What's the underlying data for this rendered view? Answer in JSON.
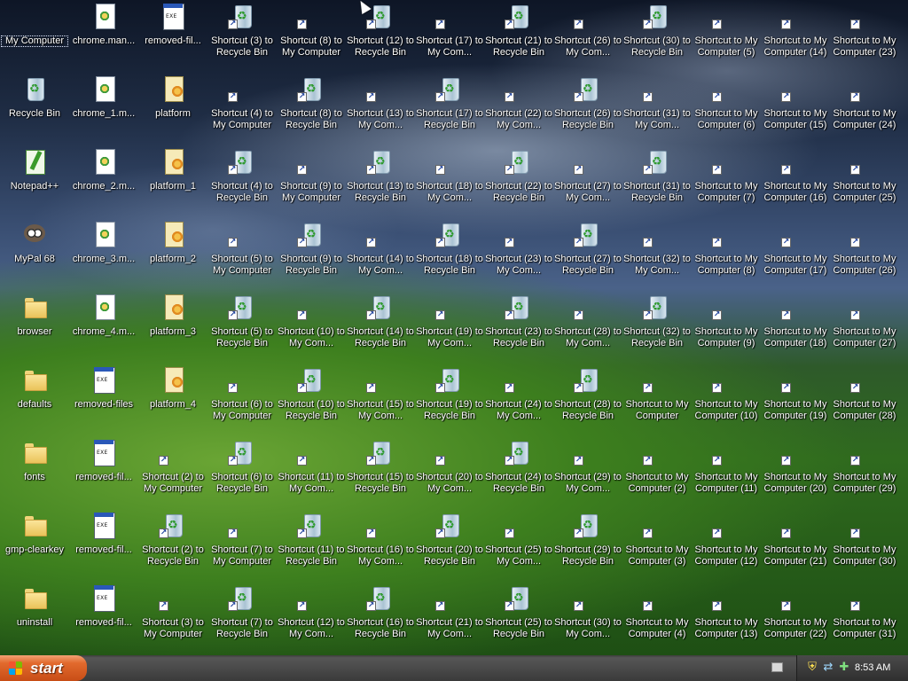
{
  "desktop": {
    "columns": [
      [
        {
          "label": "My Computer",
          "kind": "computer",
          "shortcut": false,
          "selected": true
        },
        {
          "label": "Recycle Bin",
          "kind": "bin",
          "shortcut": false
        },
        {
          "label": "Notepad++",
          "kind": "npp",
          "shortcut": false
        },
        {
          "label": "MyPal 68",
          "kind": "pal",
          "shortcut": false
        },
        {
          "label": "browser",
          "kind": "folder",
          "shortcut": false
        },
        {
          "label": "defaults",
          "kind": "folder",
          "shortcut": false
        },
        {
          "label": "fonts",
          "kind": "folder",
          "shortcut": false
        },
        {
          "label": "gmp-clearkey",
          "kind": "folder",
          "shortcut": false
        },
        {
          "label": "uninstall",
          "kind": "folder",
          "shortcut": false
        }
      ],
      [
        {
          "label": "chrome.man...",
          "kind": "doc",
          "shortcut": false
        },
        {
          "label": "chrome_1.m...",
          "kind": "doc",
          "shortcut": false
        },
        {
          "label": "chrome_2.m...",
          "kind": "doc",
          "shortcut": false
        },
        {
          "label": "chrome_3.m...",
          "kind": "doc",
          "shortcut": false
        },
        {
          "label": "chrome_4.m...",
          "kind": "doc",
          "shortcut": false
        },
        {
          "label": "removed-files",
          "kind": "exe",
          "shortcut": false
        },
        {
          "label": "removed-fil...",
          "kind": "exe",
          "shortcut": false
        },
        {
          "label": "removed-fil...",
          "kind": "exe",
          "shortcut": false
        },
        {
          "label": "removed-fil...",
          "kind": "exe",
          "shortcut": false
        }
      ],
      [
        {
          "label": "removed-fil...",
          "kind": "exe",
          "shortcut": false
        },
        {
          "label": "platform",
          "kind": "text",
          "shortcut": false
        },
        {
          "label": "platform_1",
          "kind": "text",
          "shortcut": false
        },
        {
          "label": "platform_2",
          "kind": "text",
          "shortcut": false
        },
        {
          "label": "platform_3",
          "kind": "text",
          "shortcut": false
        },
        {
          "label": "platform_4",
          "kind": "text",
          "shortcut": false
        },
        {
          "label": "Shortcut (2) to My Computer",
          "kind": "computer",
          "shortcut": true
        },
        {
          "label": "Shortcut (2) to Recycle Bin",
          "kind": "bin",
          "shortcut": true
        },
        {
          "label": "Shortcut (3) to My Computer",
          "kind": "computer",
          "shortcut": true
        }
      ],
      [
        {
          "label": "Shortcut (3) to Recycle Bin",
          "kind": "bin",
          "shortcut": true
        },
        {
          "label": "Shortcut (4) to My Computer",
          "kind": "computer",
          "shortcut": true
        },
        {
          "label": "Shortcut (4) to Recycle Bin",
          "kind": "bin",
          "shortcut": true
        },
        {
          "label": "Shortcut (5) to My Computer",
          "kind": "computer",
          "shortcut": true
        },
        {
          "label": "Shortcut (5) to Recycle Bin",
          "kind": "bin",
          "shortcut": true
        },
        {
          "label": "Shortcut (6) to My Computer",
          "kind": "computer",
          "shortcut": true
        },
        {
          "label": "Shortcut (6) to Recycle Bin",
          "kind": "bin",
          "shortcut": true
        },
        {
          "label": "Shortcut (7) to My Computer",
          "kind": "computer",
          "shortcut": true
        },
        {
          "label": "Shortcut (7) to Recycle Bin",
          "kind": "bin",
          "shortcut": true
        }
      ],
      [
        {
          "label": "Shortcut (8) to My Computer",
          "kind": "computer",
          "shortcut": true
        },
        {
          "label": "Shortcut (8) to Recycle Bin",
          "kind": "bin",
          "shortcut": true
        },
        {
          "label": "Shortcut (9) to My Computer",
          "kind": "computer",
          "shortcut": true
        },
        {
          "label": "Shortcut (9) to Recycle Bin",
          "kind": "bin",
          "shortcut": true
        },
        {
          "label": "Shortcut (10) to My Com...",
          "kind": "computer",
          "shortcut": true
        },
        {
          "label": "Shortcut (10) to Recycle Bin",
          "kind": "bin",
          "shortcut": true
        },
        {
          "label": "Shortcut (11) to My Com...",
          "kind": "computer",
          "shortcut": true
        },
        {
          "label": "Shortcut (11) to Recycle Bin",
          "kind": "bin",
          "shortcut": true
        },
        {
          "label": "Shortcut (12) to My Com...",
          "kind": "computer",
          "shortcut": true
        }
      ],
      [
        {
          "label": "Shortcut (12) to Recycle Bin",
          "kind": "bin",
          "shortcut": true
        },
        {
          "label": "Shortcut (13) to My Com...",
          "kind": "computer",
          "shortcut": true
        },
        {
          "label": "Shortcut (13) to Recycle Bin",
          "kind": "bin",
          "shortcut": true
        },
        {
          "label": "Shortcut (14) to My Com...",
          "kind": "computer",
          "shortcut": true
        },
        {
          "label": "Shortcut (14) to Recycle Bin",
          "kind": "bin",
          "shortcut": true
        },
        {
          "label": "Shortcut (15) to My Com...",
          "kind": "computer",
          "shortcut": true
        },
        {
          "label": "Shortcut (15) to Recycle Bin",
          "kind": "bin",
          "shortcut": true
        },
        {
          "label": "Shortcut (16) to My Com...",
          "kind": "computer",
          "shortcut": true
        },
        {
          "label": "Shortcut (16) to Recycle Bin",
          "kind": "bin",
          "shortcut": true
        }
      ],
      [
        {
          "label": "Shortcut (17) to My Com...",
          "kind": "computer",
          "shortcut": true
        },
        {
          "label": "Shortcut (17) to Recycle Bin",
          "kind": "bin",
          "shortcut": true
        },
        {
          "label": "Shortcut (18) to My Com...",
          "kind": "computer",
          "shortcut": true
        },
        {
          "label": "Shortcut (18) to Recycle Bin",
          "kind": "bin",
          "shortcut": true
        },
        {
          "label": "Shortcut (19) to My Com...",
          "kind": "computer",
          "shortcut": true
        },
        {
          "label": "Shortcut (19) to Recycle Bin",
          "kind": "bin",
          "shortcut": true
        },
        {
          "label": "Shortcut (20) to My Com...",
          "kind": "computer",
          "shortcut": true
        },
        {
          "label": "Shortcut (20) to Recycle Bin",
          "kind": "bin",
          "shortcut": true
        },
        {
          "label": "Shortcut (21) to My Com...",
          "kind": "computer",
          "shortcut": true
        }
      ],
      [
        {
          "label": "Shortcut (21) to Recycle Bin",
          "kind": "bin",
          "shortcut": true
        },
        {
          "label": "Shortcut (22) to My Com...",
          "kind": "computer",
          "shortcut": true
        },
        {
          "label": "Shortcut (22) to Recycle Bin",
          "kind": "bin",
          "shortcut": true
        },
        {
          "label": "Shortcut (23) to My Com...",
          "kind": "computer",
          "shortcut": true
        },
        {
          "label": "Shortcut (23) to Recycle Bin",
          "kind": "bin",
          "shortcut": true
        },
        {
          "label": "Shortcut (24) to My Com...",
          "kind": "computer",
          "shortcut": true
        },
        {
          "label": "Shortcut (24) to Recycle Bin",
          "kind": "bin",
          "shortcut": true
        },
        {
          "label": "Shortcut (25) to My Com...",
          "kind": "computer",
          "shortcut": true
        },
        {
          "label": "Shortcut (25) to Recycle Bin",
          "kind": "bin",
          "shortcut": true
        }
      ],
      [
        {
          "label": "Shortcut (26) to My Com...",
          "kind": "computer",
          "shortcut": true
        },
        {
          "label": "Shortcut (26) to Recycle Bin",
          "kind": "bin",
          "shortcut": true
        },
        {
          "label": "Shortcut (27) to My Com...",
          "kind": "computer",
          "shortcut": true
        },
        {
          "label": "Shortcut (27) to Recycle Bin",
          "kind": "bin",
          "shortcut": true
        },
        {
          "label": "Shortcut (28) to My Com...",
          "kind": "computer",
          "shortcut": true
        },
        {
          "label": "Shortcut (28) to Recycle Bin",
          "kind": "bin",
          "shortcut": true
        },
        {
          "label": "Shortcut (29) to My Com...",
          "kind": "computer",
          "shortcut": true
        },
        {
          "label": "Shortcut (29) to Recycle Bin",
          "kind": "bin",
          "shortcut": true
        },
        {
          "label": "Shortcut (30) to My Com...",
          "kind": "computer",
          "shortcut": true
        }
      ],
      [
        {
          "label": "Shortcut (30) to Recycle Bin",
          "kind": "bin",
          "shortcut": true
        },
        {
          "label": "Shortcut (31) to My Com...",
          "kind": "computer",
          "shortcut": true
        },
        {
          "label": "Shortcut (31) to Recycle Bin",
          "kind": "bin",
          "shortcut": true
        },
        {
          "label": "Shortcut (32) to My Com...",
          "kind": "computer",
          "shortcut": true
        },
        {
          "label": "Shortcut (32) to Recycle Bin",
          "kind": "bin",
          "shortcut": true
        },
        {
          "label": "Shortcut to My Computer",
          "kind": "computer",
          "shortcut": true
        },
        {
          "label": "Shortcut to My Computer (2)",
          "kind": "computer",
          "shortcut": true
        },
        {
          "label": "Shortcut to My Computer (3)",
          "kind": "computer",
          "shortcut": true
        },
        {
          "label": "Shortcut to My Computer (4)",
          "kind": "computer",
          "shortcut": true
        }
      ],
      [
        {
          "label": "Shortcut to My Computer (5)",
          "kind": "computer",
          "shortcut": true
        },
        {
          "label": "Shortcut to My Computer (6)",
          "kind": "computer",
          "shortcut": true
        },
        {
          "label": "Shortcut to My Computer (7)",
          "kind": "computer",
          "shortcut": true
        },
        {
          "label": "Shortcut to My Computer (8)",
          "kind": "computer",
          "shortcut": true
        },
        {
          "label": "Shortcut to My Computer (9)",
          "kind": "computer",
          "shortcut": true
        },
        {
          "label": "Shortcut to My Computer (10)",
          "kind": "computer",
          "shortcut": true
        },
        {
          "label": "Shortcut to My Computer (11)",
          "kind": "computer",
          "shortcut": true
        },
        {
          "label": "Shortcut to My Computer (12)",
          "kind": "computer",
          "shortcut": true
        },
        {
          "label": "Shortcut to My Computer (13)",
          "kind": "computer",
          "shortcut": true
        }
      ],
      [
        {
          "label": "Shortcut to My Computer (14)",
          "kind": "computer",
          "shortcut": true
        },
        {
          "label": "Shortcut to My Computer (15)",
          "kind": "computer",
          "shortcut": true
        },
        {
          "label": "Shortcut to My Computer (16)",
          "kind": "computer",
          "shortcut": true
        },
        {
          "label": "Shortcut to My Computer (17)",
          "kind": "computer",
          "shortcut": true
        },
        {
          "label": "Shortcut to My Computer (18)",
          "kind": "computer",
          "shortcut": true
        },
        {
          "label": "Shortcut to My Computer (19)",
          "kind": "computer",
          "shortcut": true
        },
        {
          "label": "Shortcut to My Computer (20)",
          "kind": "computer",
          "shortcut": true
        },
        {
          "label": "Shortcut to My Computer (21)",
          "kind": "computer",
          "shortcut": true
        },
        {
          "label": "Shortcut to My Computer (22)",
          "kind": "computer",
          "shortcut": true
        }
      ],
      [
        {
          "label": "Shortcut to My Computer (23)",
          "kind": "computer",
          "shortcut": true
        },
        {
          "label": "Shortcut to My Computer (24)",
          "kind": "computer",
          "shortcut": true
        },
        {
          "label": "Shortcut to My Computer (25)",
          "kind": "computer",
          "shortcut": true
        },
        {
          "label": "Shortcut to My Computer (26)",
          "kind": "computer",
          "shortcut": true
        },
        {
          "label": "Shortcut to My Computer (27)",
          "kind": "computer",
          "shortcut": true
        },
        {
          "label": "Shortcut to My Computer (28)",
          "kind": "computer",
          "shortcut": true
        },
        {
          "label": "Shortcut to My Computer (29)",
          "kind": "computer",
          "shortcut": true
        },
        {
          "label": "Shortcut to My Computer (30)",
          "kind": "computer",
          "shortcut": true
        },
        {
          "label": "Shortcut to My Computer (31)",
          "kind": "computer",
          "shortcut": true
        }
      ]
    ]
  },
  "taskbar": {
    "start_label": "start",
    "clock": "8:53 AM",
    "tray_icons": [
      "keyboard-icon",
      "security-shield-icon",
      "network-icon",
      "safely-remove-hardware-icon"
    ],
    "colors": {
      "start_orange": "#e26a2d",
      "taskbar_gray": "#4a4a4a"
    }
  }
}
